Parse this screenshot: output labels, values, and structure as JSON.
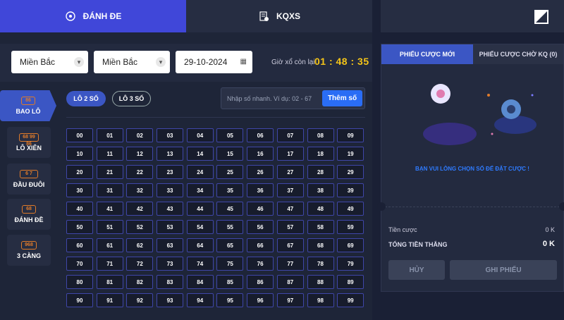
{
  "tabs": {
    "main": "ĐÁNH ĐE",
    "results": "KQXS"
  },
  "filters": {
    "region1": "Miền Bắc",
    "region2": "Miền Bắc",
    "date": "29-10-2024",
    "countdown_label": "Giờ xổ còn lại",
    "countdown": "01 : 48 : 35"
  },
  "sidebar": {
    "items": [
      {
        "label": "BAO LÔ",
        "badge": "86"
      },
      {
        "label": "LÔ XIÊN",
        "badge": "68 99 86"
      },
      {
        "label": "ĐẦU ĐUÔI",
        "badge": "6 7"
      },
      {
        "label": "ĐÁNH ĐỀ",
        "badge": "68"
      },
      {
        "label": "3 CÀNG",
        "badge": "968"
      }
    ]
  },
  "bet_types": {
    "lo2": "LÔ 2 SỐ",
    "lo3": "LÔ 3 SỐ"
  },
  "quick_input": {
    "placeholder": "Nhập số nhanh. Ví dụ: 02 - 67",
    "button": "Thêm số"
  },
  "numbers": [
    "00",
    "01",
    "02",
    "03",
    "04",
    "05",
    "06",
    "07",
    "08",
    "09",
    "10",
    "11",
    "12",
    "13",
    "14",
    "15",
    "16",
    "17",
    "18",
    "19",
    "20",
    "21",
    "22",
    "23",
    "24",
    "25",
    "26",
    "27",
    "28",
    "29",
    "30",
    "31",
    "32",
    "33",
    "34",
    "35",
    "36",
    "37",
    "38",
    "39",
    "40",
    "41",
    "42",
    "43",
    "44",
    "45",
    "46",
    "47",
    "48",
    "49",
    "50",
    "51",
    "52",
    "53",
    "54",
    "55",
    "56",
    "57",
    "58",
    "59",
    "60",
    "61",
    "62",
    "63",
    "64",
    "65",
    "66",
    "67",
    "68",
    "69",
    "70",
    "71",
    "72",
    "73",
    "74",
    "75",
    "76",
    "77",
    "78",
    "79",
    "80",
    "81",
    "82",
    "83",
    "84",
    "85",
    "86",
    "87",
    "88",
    "89",
    "90",
    "91",
    "92",
    "93",
    "94",
    "95",
    "96",
    "97",
    "98",
    "99"
  ],
  "slip": {
    "tab_new": "PHIẾU CƯỢC MỚI",
    "tab_pending": "PHIẾU CƯỢC CHỜ KQ (0)",
    "empty_message": "BẠN VUI LÒNG CHỌN SỐ ĐỂ ĐẶT CƯỢC !",
    "stake_label": "Tiền cược",
    "stake_value": "0 K",
    "total_win_label": "TỔNG TIỀN THẮNG",
    "total_win_value": "0 K",
    "cancel": "HỦY",
    "save": "GHI PHIẾU"
  },
  "colors": {
    "accent": "#4047d9",
    "countdown": "#f5c518",
    "primary_button": "#2a6df5",
    "message": "#2f7bff"
  }
}
